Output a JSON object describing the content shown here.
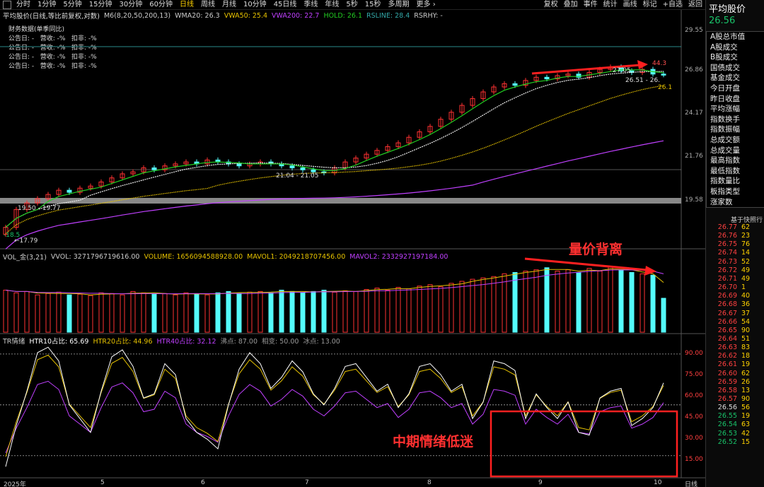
{
  "toolbar": {
    "periods": [
      "分时",
      "1分钟",
      "5分钟",
      "15分钟",
      "30分钟",
      "60分钟",
      "日线",
      "周线",
      "月线",
      "10分钟",
      "45日线",
      "季线",
      "年线",
      "5秒",
      "15秒",
      "多周期",
      "更多 ›"
    ],
    "active_period": "日线",
    "right_items": [
      "复权",
      "叠加",
      "事件",
      "统计",
      "画线",
      "标记",
      "+自选",
      "返回"
    ]
  },
  "price_panel": {
    "title": "平均股价(日线,等比前复权,对数)",
    "indicators": [
      {
        "name": "M6(8,20,50,200,13)",
        "color": "#cccccc"
      },
      {
        "name": "WMA20: 26.3",
        "color": "#cccccc"
      },
      {
        "name": "VWA50: 25.4",
        "color": "#e6c200"
      },
      {
        "name": "VWA200: 22.7",
        "color": "#c040ff"
      },
      {
        "name": "HOLD: 26.1",
        "color": "#22cc22"
      },
      {
        "name": "RSLINE: 28.4",
        "color": "#33aaaa"
      },
      {
        "name": "RSRHY: -",
        "color": "#cccccc"
      }
    ],
    "fin_title": "财务数据(单季同比)",
    "fin_rows": [
      "公告日: -   营收: -%   扣非: -%",
      "公告日: -   营收: -%   扣非: -%",
      "公告日: -   营收: -%   扣非: -%",
      "公告日: -   营收: -%   扣非: -%"
    ],
    "y_ticks": [
      "29.55",
      "26.86",
      "24.17",
      "21.76",
      "19.58"
    ],
    "annotations": {
      "high": "44.3",
      "recent_high": "27.05",
      "range_right": "26.51 - 26.",
      "hold_val": "26.1",
      "range_mid": "21.04 - 21.05",
      "range_left": "19.50 - 19.77",
      "low_left": "-18.5",
      "low": "←17.79"
    }
  },
  "volume_panel": {
    "indicators": [
      {
        "name": "VOL_金(3,21)",
        "color": "#cccccc"
      },
      {
        "name": "VVOL: 3271796719616.00",
        "color": "#cccccc"
      },
      {
        "name": "VOLUME: 1656094588928.00",
        "color": "#e6c200"
      },
      {
        "name": "MAVOL1: 2049218707456.00",
        "color": "#e6c200"
      },
      {
        "name": "MAVOL2: 2332927197184.00",
        "color": "#c040ff"
      }
    ],
    "annotation": "量价背离"
  },
  "tr_panel": {
    "indicators": [
      {
        "name": "TR情绪",
        "color": "#cccccc"
      },
      {
        "name": "HTR10占比: 65.69",
        "color": "#ffffff"
      },
      {
        "name": "HTR20占比: 44.96",
        "color": "#e6c200"
      },
      {
        "name": "HTR40占比: 32.12",
        "color": "#c040ff"
      },
      {
        "name": "沸点: 87.00",
        "color": "#999999"
      },
      {
        "name": "相变: 50.00",
        "color": "#999999"
      },
      {
        "name": "冰点: 13.00",
        "color": "#999999"
      }
    ],
    "y_ticks": [
      "90.00",
      "75.00",
      "60.00",
      "45.00",
      "30.00",
      "15.00"
    ],
    "annotation": "中期情绪低迷"
  },
  "x_axis": {
    "labels": [
      "2025年",
      "5",
      "6",
      "7",
      "8",
      "9",
      "10"
    ],
    "period_label": "日线"
  },
  "sidebar": {
    "title": "平均股价",
    "price": "26.56",
    "menu": [
      "A股总市值",
      "A股成交",
      "B股成交",
      "国债成交",
      "基金成交",
      "今日开盘",
      "昨日收盘",
      "平均涨幅",
      "指数换手",
      "指数振幅",
      "总成交额",
      "总成交量",
      "最高指数",
      "最低指数",
      "指数量比",
      "板指类型",
      "涨家数"
    ],
    "orderbook_title": "基于快照行",
    "orderbook": [
      [
        "26.77",
        "62"
      ],
      [
        "26.76",
        "23"
      ],
      [
        "26.75",
        "76"
      ],
      [
        "26.74",
        "14"
      ],
      [
        "26.73",
        "52"
      ],
      [
        "26.72",
        "49"
      ],
      [
        "26.71",
        "49"
      ],
      [
        "26.70",
        "1"
      ],
      [
        "26.69",
        "40"
      ],
      [
        "26.68",
        "36"
      ],
      [
        "26.67",
        "37"
      ],
      [
        "26.66",
        "54"
      ],
      [
        "26.65",
        "90"
      ],
      [
        "26.64",
        "51"
      ],
      [
        "26.63",
        "83"
      ],
      [
        "26.62",
        "18"
      ],
      [
        "26.61",
        "19"
      ],
      [
        "26.60",
        "62"
      ],
      [
        "26.59",
        "26"
      ],
      [
        "26.58",
        "13"
      ],
      [
        "26.57",
        "90"
      ],
      [
        "26.56",
        "56"
      ],
      [
        "26.55",
        "19"
      ],
      [
        "26.54",
        "63"
      ],
      [
        "26.53",
        "42"
      ],
      [
        "26.52",
        "15"
      ]
    ]
  },
  "colors": {
    "up": "#ff3232",
    "down": "#54fcfc",
    "bg": "#000000",
    "accent": "#ffd200"
  },
  "chart_data": [
    {
      "type": "candlestick",
      "title": "平均股价(日线,等比前复权,对数)",
      "ylim": [
        17.79,
        29.55
      ],
      "close": [
        18.5,
        19.3,
        19.6,
        19.8,
        20.0,
        20.2,
        20.1,
        20.3,
        20.4,
        20.6,
        20.8,
        21.0,
        21.1,
        21.3,
        21.2,
        21.4,
        21.5,
        21.6,
        21.5,
        21.7,
        21.6,
        21.5,
        21.4,
        21.5,
        21.6,
        21.5,
        21.4,
        21.3,
        21.2,
        21.1,
        21.05,
        21.3,
        21.6,
        21.8,
        22.0,
        22.2,
        22.4,
        22.6,
        22.9,
        23.2,
        23.5,
        23.9,
        24.3,
        24.7,
        25.1,
        25.5,
        25.8,
        26.0,
        25.9,
        26.2,
        26.4,
        26.3,
        26.5,
        26.6,
        26.4,
        26.7,
        26.9,
        27.05,
        26.8,
        26.7,
        26.9,
        26.6,
        26.56
      ],
      "series": [
        {
          "name": "WMA20",
          "last": 26.3
        },
        {
          "name": "VWA50",
          "last": 25.4
        },
        {
          "name": "VWA200",
          "last": 22.7
        },
        {
          "name": "HOLD",
          "last": 26.1
        }
      ]
    },
    {
      "type": "bar",
      "title": "VOL_金(3,21)",
      "values": [
        0.62,
        0.58,
        0.6,
        0.55,
        0.57,
        0.59,
        0.55,
        0.56,
        0.54,
        0.58,
        0.57,
        0.55,
        0.6,
        0.58,
        0.56,
        0.57,
        0.55,
        0.58,
        0.56,
        0.55,
        0.58,
        0.6,
        0.57,
        0.59,
        0.6,
        0.58,
        0.62,
        0.6,
        0.58,
        0.6,
        0.62,
        0.59,
        0.61,
        0.6,
        0.63,
        0.65,
        0.62,
        0.66,
        0.64,
        0.68,
        0.7,
        0.67,
        0.72,
        0.75,
        0.78,
        0.8,
        0.82,
        0.86,
        0.88,
        0.9,
        0.92,
        0.95,
        0.9,
        0.92,
        0.88,
        0.94,
        0.9,
        0.96,
        0.92,
        0.88,
        0.86,
        0.84,
        0.5
      ],
      "series": [
        {
          "name": "MAVOL1"
        },
        {
          "name": "MAVOL2"
        }
      ]
    },
    {
      "type": "line",
      "title": "TR情绪",
      "ylim": [
        0,
        100
      ],
      "series": [
        {
          "name": "HTR10占比",
          "last": 65.69
        },
        {
          "name": "HTR20占比",
          "last": 44.96
        },
        {
          "name": "HTR40占比",
          "last": 32.12
        }
      ],
      "reference_lines": [
        {
          "name": "沸点",
          "value": 87
        },
        {
          "name": "相变",
          "value": 50
        },
        {
          "name": "冰点",
          "value": 13
        }
      ]
    }
  ]
}
